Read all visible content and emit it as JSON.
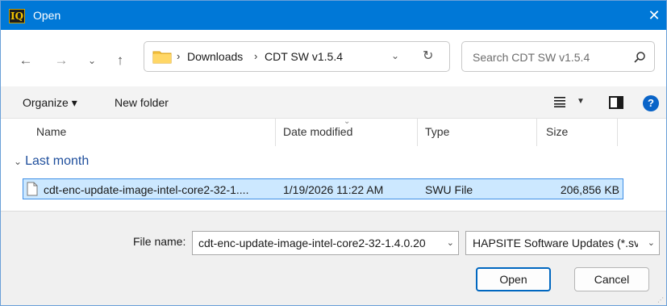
{
  "window": {
    "title": "Open",
    "app_icon_text": "IQ",
    "close_glyph": "✕"
  },
  "nav": {
    "back_glyph": "←",
    "forward_glyph": "→",
    "recent_glyph": "⌄",
    "up_glyph": "↑"
  },
  "address": {
    "separator": "›",
    "crumbs": [
      "Downloads",
      "CDT SW v1.5.4"
    ],
    "dropdown_glyph": "⌄",
    "refresh_glyph": "↻"
  },
  "search": {
    "placeholder": "Search CDT SW v1.5.4"
  },
  "toolbar": {
    "organize_label": "Organize ▾",
    "new_folder_label": "New folder",
    "view_caret": "▼",
    "help_glyph": "?"
  },
  "columns": {
    "name": "Name",
    "date_modified": "Date modified",
    "type": "Type",
    "size": "Size",
    "sort_glyph": "⌄"
  },
  "groups": [
    {
      "label": "Last month",
      "chevron": "⌄",
      "files": [
        {
          "name": "cdt-enc-update-image-intel-core2-32-1....",
          "date_modified": "1/19/2026 11:22 AM",
          "type": "SWU File",
          "size": "206,856 KB"
        }
      ]
    }
  ],
  "bottom": {
    "file_name_label": "File name:",
    "file_name_value": "cdt-enc-update-image-intel-core2-32-1.4.0.20",
    "file_type_value": "HAPSITE Software Updates (*.sv",
    "dropdown_glyph": "⌄",
    "open_label": "Open",
    "cancel_label": "Cancel"
  },
  "colors": {
    "titlebar": "#0078d7",
    "selection_fill": "#cce8ff",
    "selection_border": "#3d8ee6",
    "group_header": "#1e4e9c",
    "folder": "#f5c342"
  }
}
